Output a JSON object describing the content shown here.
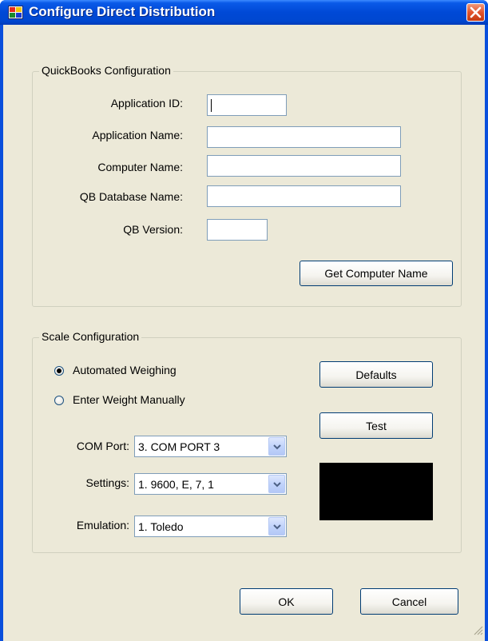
{
  "window": {
    "title": "Configure Direct Distribution",
    "close_icon": "close-icon",
    "app_icon": "application-icon"
  },
  "quickbooks": {
    "group_label": "QuickBooks Configuration",
    "application_id_label": "Application ID:",
    "application_id_value": "",
    "application_name_label": "Application Name:",
    "application_name_value": "",
    "computer_name_label": "Computer Name:",
    "computer_name_value": "",
    "qb_database_name_label": "QB Database Name:",
    "qb_database_name_value": "",
    "qb_version_label": "QB Version:",
    "qb_version_value": "",
    "get_computer_name_button": "Get Computer Name"
  },
  "scale": {
    "group_label": "Scale Configuration",
    "radio_automated": "Automated Weighing",
    "radio_manual": "Enter Weight Manually",
    "selected_mode": "Automated Weighing",
    "defaults_button": "Defaults",
    "test_button": "Test",
    "com_port_label": "COM Port:",
    "com_port_value": "3. COM PORT 3",
    "settings_label": "Settings:",
    "settings_value": "1. 9600, E, 7, 1",
    "emulation_label": "Emulation:",
    "emulation_value": "1. Toledo",
    "display_color": "#000000"
  },
  "footer": {
    "ok_button": "OK",
    "cancel_button": "Cancel"
  },
  "colors": {
    "titlebar": "#0047d0",
    "dialog_background": "#ece9d8",
    "close_button": "#e2532c"
  }
}
